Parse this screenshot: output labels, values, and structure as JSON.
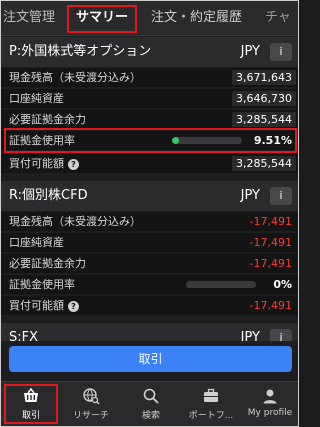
{
  "tabs": [
    {
      "label": "注文管理"
    },
    {
      "label": "サマリー"
    },
    {
      "label": "注文・約定履歴"
    },
    {
      "label": "チャ"
    }
  ],
  "sections": [
    {
      "title": "P:外国株式等オプション",
      "currency": "JPY",
      "info_label": "i",
      "rows": [
        {
          "label": "現金残高（未受渡分込み）",
          "value": "3,671,643"
        },
        {
          "label": "口座純資産",
          "value": "3,646,730"
        },
        {
          "label": "必要証拠金余力",
          "value": "3,285,544"
        },
        {
          "label": "証拠金使用率",
          "value": "9.51%",
          "usage_fraction": 0.0951
        },
        {
          "label": "買付可能額",
          "value": "3,285,544",
          "help": "?"
        }
      ]
    },
    {
      "title": "R:個別株CFD",
      "currency": "JPY",
      "info_label": "i",
      "rows": [
        {
          "label": "現金残高（未受渡分込み）",
          "value": "-17,491"
        },
        {
          "label": "口座純資産",
          "value": "-17,491"
        },
        {
          "label": "必要証拠金余力",
          "value": "-17,491"
        },
        {
          "label": "証拠金使用率",
          "value": "0%",
          "usage_fraction": 0.0
        },
        {
          "label": "買付可能額",
          "value": "-17,491",
          "help": "?"
        }
      ]
    },
    {
      "title": "S:FX",
      "currency": "JPY",
      "info_label": "i"
    }
  ],
  "trade_button": {
    "label": "取引"
  },
  "bottom_nav": [
    {
      "label": "取引",
      "icon": "basket-icon"
    },
    {
      "label": "リサーチ",
      "icon": "globe-search-icon"
    },
    {
      "label": "検索",
      "icon": "search-icon"
    },
    {
      "label": "ポートフ...",
      "icon": "briefcase-icon"
    },
    {
      "label": "My profile",
      "icon": "person-icon"
    }
  ],
  "colors": {
    "accent": "#3b82f6",
    "negative": "#ff3b30",
    "gauge_fill": "#2ecc71",
    "highlight_border": "#e01a1a"
  }
}
